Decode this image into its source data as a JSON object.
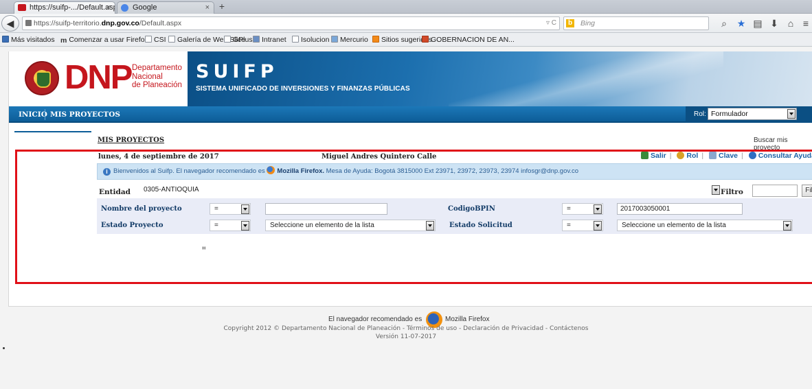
{
  "browser": {
    "tabs": [
      {
        "title": "https://suifp-.../Default.aspx",
        "active": true
      },
      {
        "title": "Google",
        "active": false
      }
    ],
    "new_tab": "+",
    "close_glyph": "×",
    "url_prefix": "https://suifp-territorio.",
    "url_domain": "dnp.gov.co",
    "url_suffix": "/Default.aspx",
    "url_controls": "▿ C",
    "search_engine": "Bing",
    "bookmarks": [
      "Más visitados",
      "Comenzar a usar Firefox",
      "CSI",
      "Galería de Web Slice",
      "GPlus",
      "Intranet",
      "Isolucion",
      "Mercurio",
      "Sitios sugeridos",
      "GOBERNACION DE AN..."
    ]
  },
  "header": {
    "logo_text": "DNP",
    "logo_sub": [
      "Departamento",
      "Nacional",
      "de Planeación"
    ],
    "app_title": "SUIFP",
    "app_subtitle": "SISTEMA UNIFICADO DE INVERSIONES Y FINANZAS PÚBLICAS"
  },
  "menu": {
    "items": [
      "INICIO",
      "MIS PROYECTOS"
    ],
    "rol_label": "Rol:",
    "rol_value": "Formulador"
  },
  "main": {
    "title": "MIS PROYECTOS",
    "buscar_link": "Buscar mis proyecto",
    "date": "lunes, 4 de septiembre de 2017",
    "user": "Miguel Andres Quintero Calle",
    "links": [
      "Salir",
      "Rol",
      "Clave",
      "Consultar Ayuda"
    ],
    "notice_prefix": "Bienvenidos al Suifp. El navegador recomendado es",
    "notice_browser": "Mozilla Firefox.",
    "notice_suffix": "Mesa de Ayuda: Bogotá 3815000 Ext 23971, 23972, 23973, 23974 infosgr@dnp.gov.co",
    "entidad_label": "Entidad",
    "entidad_value": "0305-ANTIOQUIA",
    "filtro_label": "Filtro",
    "filtro_value": "",
    "filtrar_button": "Filtrar"
  },
  "search": {
    "nombre_label": "Nombre del proyecto",
    "nombre_op": "=",
    "nombre_value": "",
    "codigo_label": "CodigoBPIN",
    "codigo_op": "=",
    "codigo_value": "2017003050001",
    "estado_label": "Estado Proyecto",
    "estado_op": "=",
    "estado_value": "Seleccione un elemento de la lista",
    "solicitud_label": "Estado Solicitud",
    "solicitud_op": "=",
    "solicitud_value": "Seleccione un elemento de la lista"
  },
  "footer": {
    "recommended": "El navegador recomendado es",
    "browser_name": "Mozilla Firefox",
    "copyright": "Copyright 2012 © Departamento Nacional de Planeación - Términos de uso - Declaración de Privacidad - Contáctenos",
    "version": "Versión 11-07-2017"
  },
  "colors": {
    "brand_red": "#c5161d",
    "menu_blue": "#0d5d98",
    "highlight": "#e01018"
  }
}
